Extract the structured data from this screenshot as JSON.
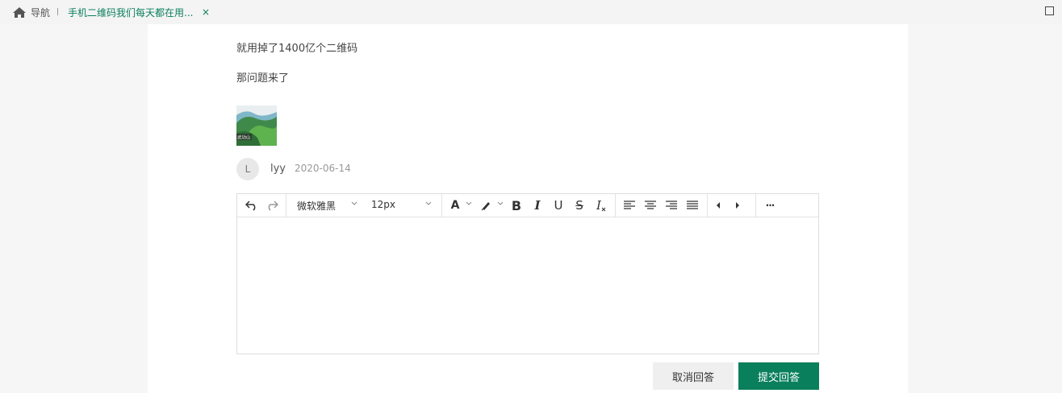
{
  "topbar": {
    "home_label": "导航",
    "tab_label": "手机二维码我们每天都在用...",
    "tab_close": "×",
    "colors": {
      "accent": "#0a7f5b"
    }
  },
  "content": {
    "paragraphs": [
      "就用掉了1400亿个二维码",
      "那问题来了"
    ],
    "thumbnail_caption": "武功山"
  },
  "answer_meta": {
    "avatar_letter": "L",
    "username": "lyy",
    "date": "2020-06-14"
  },
  "editor": {
    "font_family": "微软雅黑",
    "font_size": "12px",
    "text_color_letter": "A",
    "bold": "B",
    "italic": "I",
    "underline": "U",
    "strike": "S",
    "clear_format": "I",
    "more": "···",
    "icons": [
      "undo-icon",
      "redo-icon",
      "text-color-icon",
      "highlight-icon",
      "bold-icon",
      "italic-icon",
      "underline-icon",
      "strikethrough-icon",
      "clear-format-icon",
      "align-left-icon",
      "align-center-icon",
      "align-right-icon",
      "align-justify-icon",
      "outdent-icon",
      "indent-icon",
      "more-icon"
    ]
  },
  "actions": {
    "cancel": "取消回答",
    "submit": "提交回答"
  }
}
